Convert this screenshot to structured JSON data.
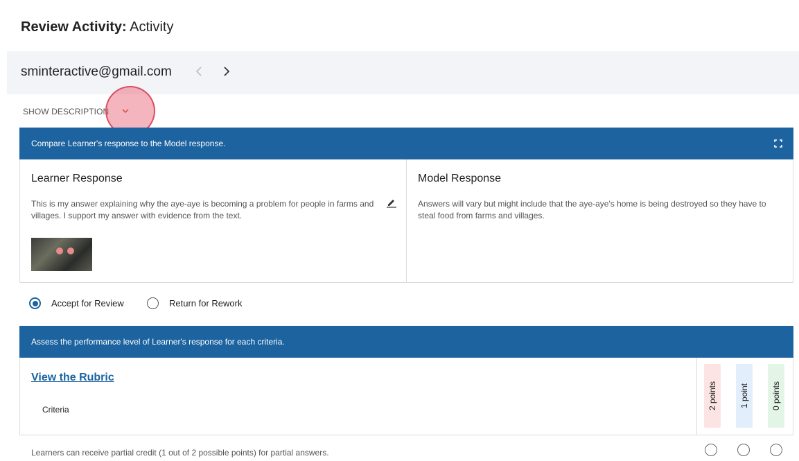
{
  "page": {
    "title_bold": "Review Activity:",
    "title_rest": " Activity"
  },
  "user": {
    "email": "sminteractive@gmail.com",
    "prev_icon": "chevron-left-icon",
    "next_icon": "chevron-right-icon"
  },
  "description": {
    "toggle_label": "SHOW DESCRIPTION",
    "chevron_icon": "chevron-down-icon"
  },
  "compare": {
    "banner": "Compare Learner's response to the Model response.",
    "expand_icon": "fullscreen-icon",
    "learner": {
      "heading": "Learner Response",
      "text": "This is my answer explaining why the aye-aye is becoming a problem for people in farms and villages. I support my answer with evidence from the text."
    },
    "model": {
      "heading": "Model Response",
      "text": "Answers will vary but might include that the aye-aye's home is being destroyed so they have to steal food from farms and villages."
    }
  },
  "review": {
    "accept_label": "Accept for Review",
    "return_label": "Return for Rework",
    "selected": "accept"
  },
  "assess": {
    "banner": "Assess the performance level of Learner's response for each criteria.",
    "rubric_link": "View the Rubric",
    "criteria_header": "Criteria",
    "points": [
      "2 points",
      "1 point",
      "0 points"
    ],
    "rows": [
      {
        "text": "Learners can receive partial credit (1 out of 2 possible points) for partial answers."
      }
    ]
  },
  "colors": {
    "primary_blue": "#1c63a0",
    "pill_2": "#fde4e4",
    "pill_1": "#e2eefc",
    "pill_0": "#e3f5e7",
    "click_ring": "#e85c6e"
  }
}
